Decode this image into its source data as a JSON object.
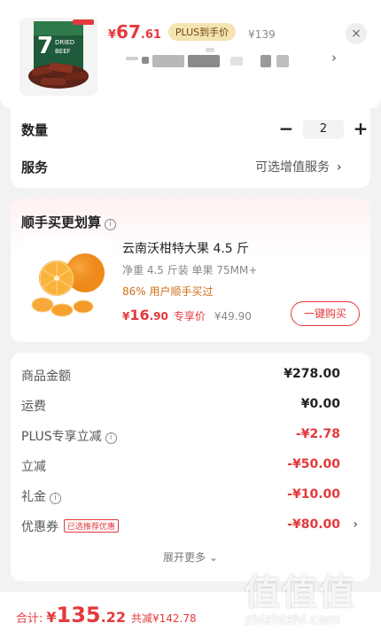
{
  "product": {
    "image": "dried-beef-package",
    "price_yen": "¥",
    "price_int": "67",
    "price_dec": ".61",
    "plus_tag": "PLUS到手价",
    "original_price": "¥139",
    "spec_chevron": "›",
    "close_icon": "×"
  },
  "quantity": {
    "label": "数量",
    "value": "2",
    "minus": "−",
    "plus": "+"
  },
  "service": {
    "label": "服务",
    "value": "可选增值服务",
    "chevron": "›"
  },
  "bundle": {
    "title": "顺手买更划算",
    "info_icon": "i",
    "image": "orange-fruit",
    "name": "云南沃柑特大果 4.5 斤",
    "spec": "净重 4.5 斤装 单果 75MM+",
    "social": "86% 用户顺手买过",
    "price_yen": "¥",
    "price_int": "16",
    "price_dec": ".90",
    "price_tag": "专享价",
    "original_price": "¥49.90",
    "buy_button": "一键购买"
  },
  "details": {
    "rows": [
      {
        "label": "商品金额",
        "value": "¥278.00"
      },
      {
        "label": "运费",
        "value": "¥0.00"
      },
      {
        "label": "PLUS专享立减",
        "value": "-¥2.78"
      },
      {
        "label": "立减",
        "value": "-¥50.00"
      },
      {
        "label": "礼金",
        "value": "-¥10.00"
      },
      {
        "label": "优惠券",
        "value": "-¥80.00",
        "tag": "已选推荐优惠"
      }
    ],
    "expand_label": "展开更多",
    "expand_icon": "⌄",
    "row_chevron": "›"
  },
  "footer": {
    "total_label": "合计:",
    "total_yen": "¥",
    "total_int": "135",
    "total_dec": ".22",
    "discount_text": "共减¥142.78"
  },
  "watermark": {
    "logo": "值值值",
    "domain": "zhizhizhi.com"
  },
  "colors": {
    "accent": "#e4393c",
    "plus_gold": "#f5e3b3",
    "social_orange": "#d07018",
    "background": "#f2f2f2"
  }
}
